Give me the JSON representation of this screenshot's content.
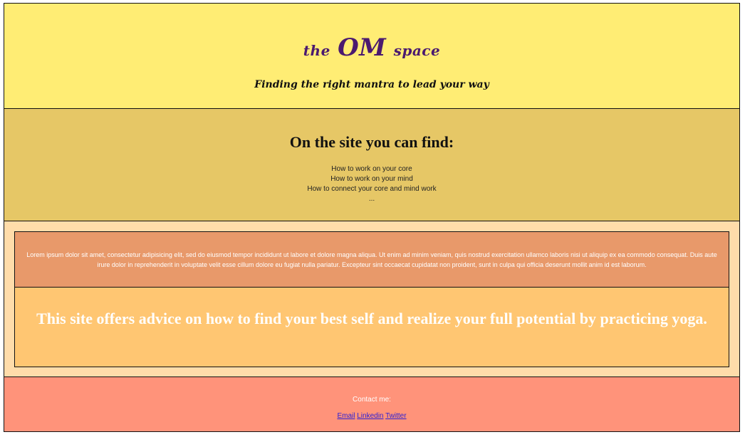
{
  "header": {
    "logo_part1": "the",
    "logo_part2": "OM",
    "logo_part3": "space",
    "tagline": "Finding the right mantra to lead your way"
  },
  "features": {
    "heading": "On the site you can find:",
    "items": [
      "How to work on your core",
      "How to work on your mind",
      "How to connect your core and mind work",
      "..."
    ]
  },
  "content": {
    "lorem": "Lorem ipsum dolor sit amet, consectetur adipisicing elit, sed do eiusmod tempor incididunt ut labore et dolore magna aliqua. Ut enim ad minim veniam, quis nostrud exercitation ullamco laboris nisi ut aliquip ex ea commodo consequat. Duis aute irure dolor in reprehenderit in voluptate velit esse cillum dolore eu fugiat nulla pariatur. Excepteur sint occaecat cupidatat non proident, sunt in culpa qui officia deserunt mollit anim id est laborum.",
    "offer": "This site offers advice on how to find your best self and realize your full potential by practicing yoga."
  },
  "footer": {
    "contact_label": "Contact me:",
    "links": {
      "email": "Email",
      "linkedin": "Linkedin",
      "twitter": "Twitter"
    }
  },
  "colors": {
    "header_bg": "#ffed74",
    "features_bg": "#e6c766",
    "content_bg": "#ffdcaa",
    "lorem_bg": "#e8996a",
    "offer_bg": "#ffc672",
    "footer_bg": "#ff937a",
    "logo_color": "#4b1a6f",
    "link_color": "#2a1fd6"
  }
}
